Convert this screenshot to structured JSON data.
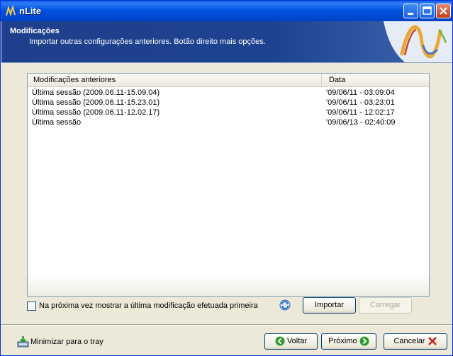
{
  "window": {
    "title": "nLite"
  },
  "header": {
    "title": "Modificações",
    "subtitle": "Importar outras configurações anteriores. Botão direito mais opções."
  },
  "list": {
    "columns": [
      "Modificações anteriores",
      "Data"
    ],
    "rows": [
      {
        "name": "Última sessão (2009.06.11-15.09.04)",
        "date": "'09/06/11 - 03:09:04"
      },
      {
        "name": "Última sessão (2009.06.11-15.23.01)",
        "date": "'09/06/11 - 03:23:01"
      },
      {
        "name": "Última sessão (2009.06.11-12.02.17)",
        "date": "'09/06/11 - 12:02:17"
      },
      {
        "name": "Última sessão",
        "date": "'09/06/13 - 02:40:09"
      }
    ]
  },
  "options": {
    "checkbox_label": "Na próxima vez mostrar a última modificação efetuada primeira",
    "checked": false,
    "import_label": "Importar",
    "load_label": "Carregar"
  },
  "footer": {
    "tray_label": "Minimizar para o tray",
    "back_label": "Voltar",
    "next_label": "Próximo",
    "cancel_label": "Cancelar"
  },
  "icons": [
    "nlite-app-icon",
    "minimize-icon",
    "maximize-icon",
    "close-icon",
    "nlite-logo",
    "refresh-icon",
    "tray-icon",
    "back-arrow-icon",
    "next-arrow-icon",
    "cancel-x-icon"
  ],
  "colors": {
    "titlebar": "#0054e3",
    "header_bg": "#1d4390",
    "window_bg": "#ece9d8",
    "cancel_x": "#c81e1e"
  }
}
